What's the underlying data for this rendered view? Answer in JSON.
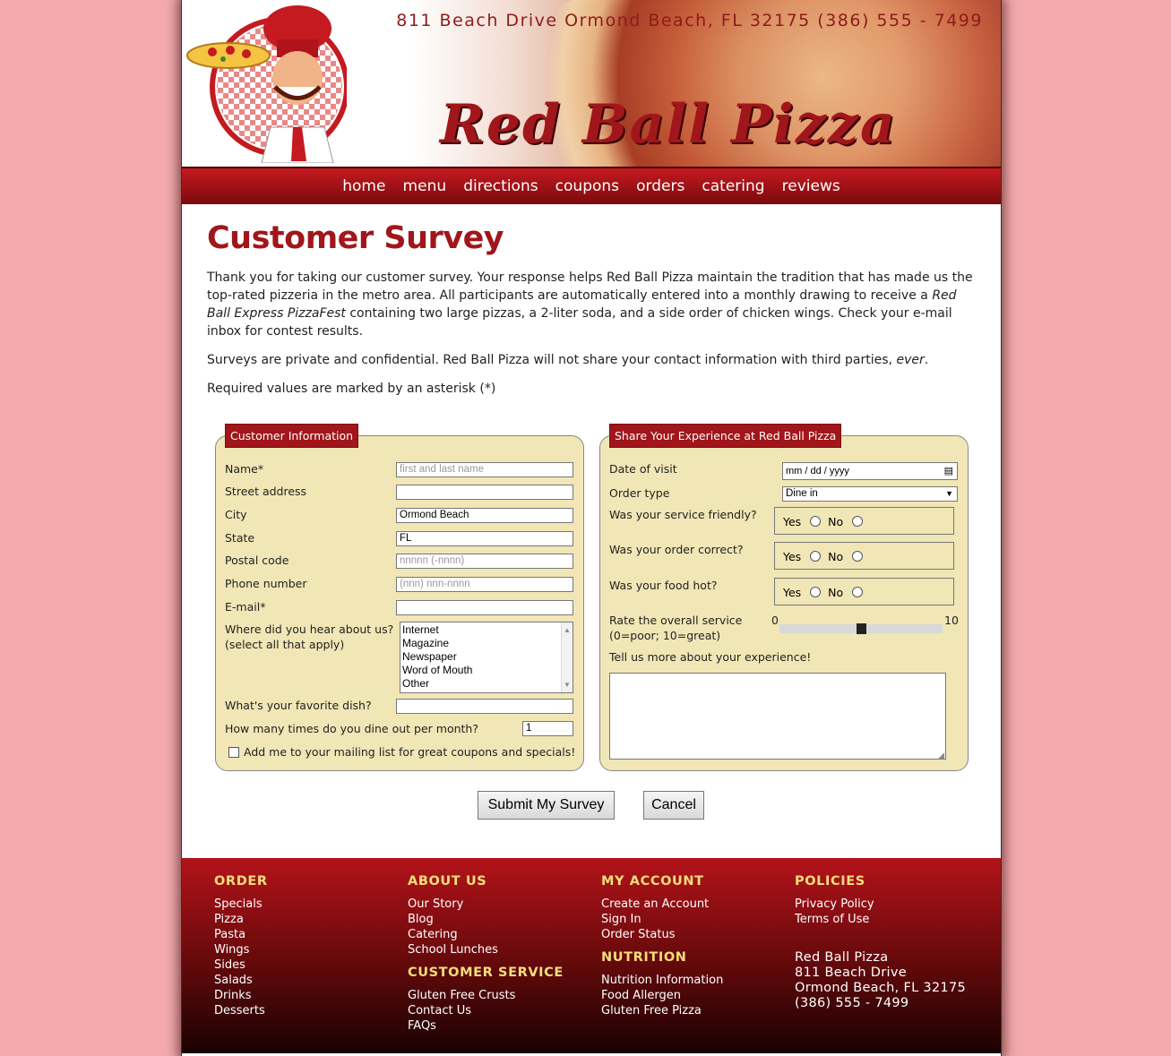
{
  "header": {
    "address_line": "811 Beach Drive  Ormond Beach, FL 32175   (386) 555 - 7499",
    "logo_text": "Red Ball Pizza"
  },
  "nav": [
    "home",
    "menu",
    "directions",
    "coupons",
    "orders",
    "catering",
    "reviews"
  ],
  "page_title": "Customer Survey",
  "intro": {
    "p1_a": "Thank you for taking our customer survey. Your response helps Red Ball Pizza maintain the tradition that has made us the top-rated pizzeria in the metro area. All participants are automatically entered into a monthly drawing to receive a ",
    "p1_em": "Red Ball Express PizzaFest",
    "p1_b": " containing two large pizzas, a 2-liter soda, and a side order of chicken wings. Check your e-mail inbox for contest results.",
    "p2_a": "Surveys are private and confidential. Red Ball Pizza will not share your contact information with third parties, ",
    "p2_em": "ever",
    "p2_b": ".",
    "p3": "Required values are marked by an asterisk (*)"
  },
  "customer_info": {
    "legend": "Customer Information",
    "name_label": "Name*",
    "name_placeholder": "first and last name",
    "street_label": "Street address",
    "city_label": "City",
    "city_value": "Ormond Beach",
    "state_label": "State",
    "state_value": "FL",
    "postal_label": "Postal code",
    "postal_placeholder": "nnnnn (-nnnn)",
    "phone_label": "Phone number",
    "phone_placeholder": "(nnn) nnn-nnnn",
    "email_label": "E-mail*",
    "hear_label_1": "Where did you hear about us?",
    "hear_label_2": "(select all that apply)",
    "hear_options": [
      "Internet",
      "Magazine",
      "Newspaper",
      "Word of Mouth",
      "Other"
    ],
    "dish_label": "What's your favorite dish?",
    "dineout_label": "How many times do you dine out per month?",
    "dineout_value": "1",
    "mailing_label": "Add me to your mailing list for great coupons and specials!"
  },
  "experience": {
    "legend": "Share Your Experience at Red Ball Pizza",
    "date_label": "Date of visit",
    "date_placeholder": "mm / dd / yyyy",
    "order_type_label": "Order type",
    "order_type_value": "Dine in",
    "q_friendly": "Was your service friendly?",
    "q_correct": "Was your order correct?",
    "q_hot": "Was your food hot?",
    "yes": "Yes",
    "no": "No",
    "rate_label_1": "Rate the overall service",
    "rate_label_2": "(0=poor; 10=great)",
    "rate_min": "0",
    "rate_max": "10",
    "rate_value": 5,
    "more_label": "Tell us more about your experience!"
  },
  "buttons": {
    "submit": "Submit My Survey",
    "cancel": "Cancel"
  },
  "footer": {
    "order": {
      "title": "ORDER",
      "links": [
        "Specials",
        "Pizza",
        "Pasta",
        "Wings",
        "Sides",
        "Salads",
        "Drinks",
        "Desserts"
      ]
    },
    "about": {
      "title": "ABOUT US",
      "links": [
        "Our Story",
        "Blog",
        "Catering",
        "School Lunches"
      ]
    },
    "service": {
      "title": "CUSTOMER SERVICE",
      "links": [
        "Gluten Free Crusts",
        "Contact Us",
        "FAQs"
      ]
    },
    "account": {
      "title": "MY ACCOUNT",
      "links": [
        "Create an Account",
        "Sign In",
        "Order Status"
      ]
    },
    "nutrition": {
      "title": "NUTRITION",
      "links": [
        "Nutrition Information",
        "Food Allergen",
        "Gluten Free Pizza"
      ]
    },
    "policies": {
      "title": "POLICIES",
      "links": [
        "Privacy Policy",
        "Terms of Use"
      ]
    },
    "address": [
      "Red Ball Pizza",
      "811 Beach Drive",
      "Ormond Beach, FL 32175",
      "(386) 555 - 7499"
    ]
  },
  "colors": {
    "background": "#f4a9ad",
    "brand_red": "#a1161b",
    "fieldset_bg": "#f1e6b6",
    "footer_heading": "#f7df7a"
  }
}
